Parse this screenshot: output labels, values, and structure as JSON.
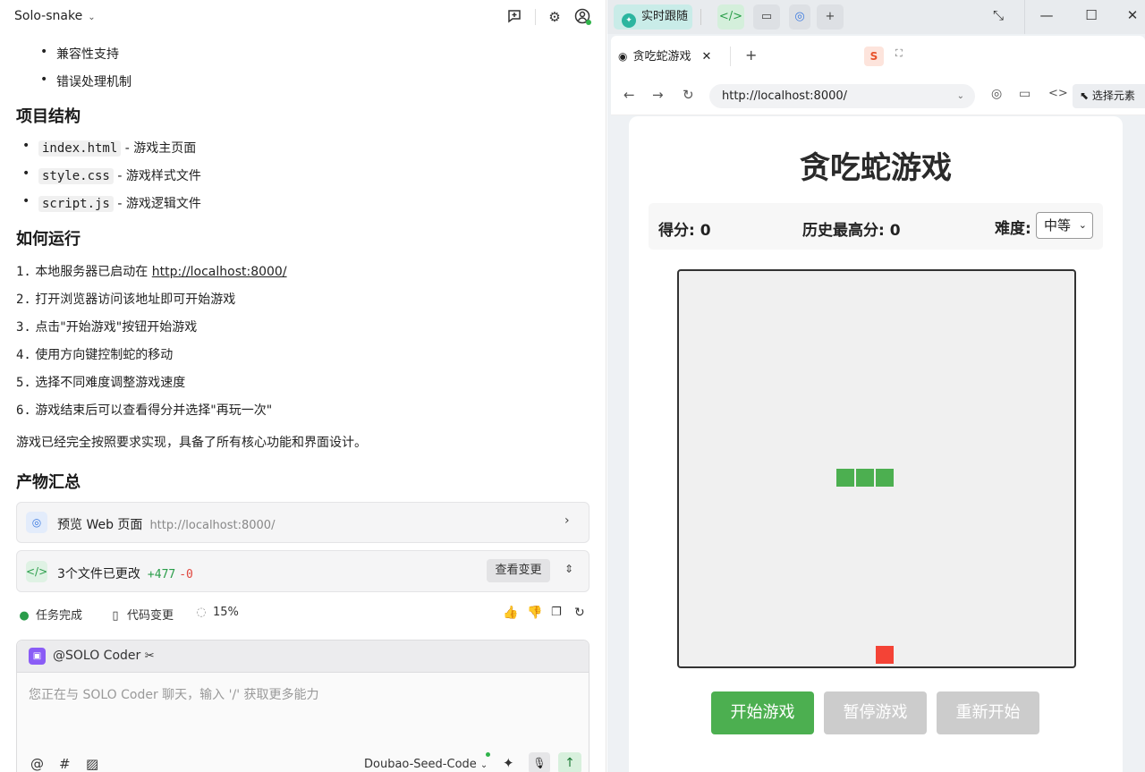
{
  "left": {
    "project_name": "Solo-snake",
    "top_bullets": [
      "兼容性支持",
      "错误处理机制"
    ],
    "structure_heading": "项目结构",
    "structure_items": [
      {
        "file": "index.html",
        "desc": "- 游戏主页面"
      },
      {
        "file": "style.css",
        "desc": "- 游戏样式文件"
      },
      {
        "file": "script.js",
        "desc": "- 游戏逻辑文件"
      }
    ],
    "run_heading": "如何运行",
    "run_steps": [
      {
        "num": "1.",
        "text": "本地服务器已启动在 ",
        "link": "http://localhost:8000/"
      },
      {
        "num": "2.",
        "text": "打开浏览器访问该地址即可开始游戏"
      },
      {
        "num": "3.",
        "text": "点击\"开始游戏\"按钮开始游戏"
      },
      {
        "num": "4.",
        "text": "使用方向键控制蛇的移动"
      },
      {
        "num": "5.",
        "text": "选择不同难度调整游戏速度"
      },
      {
        "num": "6.",
        "text": "游戏结束后可以查看得分并选择\"再玩一次\""
      }
    ],
    "summary": "游戏已经完全按照要求实现，具备了所有核心功能和界面设计。",
    "artifacts_heading": "产物汇总",
    "preview_card": {
      "label": "预览 Web 页面",
      "url": "http://localhost:8000/"
    },
    "changes_card": {
      "label": "3个文件已更改",
      "plus": "+477",
      "minus": "-0",
      "button": "查看变更"
    },
    "status": {
      "done": "任务完成",
      "code_change": "代码变更",
      "progress": "15%"
    },
    "chat": {
      "agent": "@SOLO Coder",
      "placeholder": "您正在与 SOLO Coder 聊天，输入 '/' 获取更多能力",
      "model": "Doubao-Seed-Code"
    }
  },
  "right": {
    "follow_label": "实时跟随",
    "tab_title": "贪吃蛇游戏",
    "url": "http://localhost:8000/",
    "select_element": "选择元素",
    "game": {
      "title": "贪吃蛇游戏",
      "score": "得分: 0",
      "high_score": "历史最高分: 0",
      "difficulty_label": "难度:",
      "difficulty_value": "中等",
      "buttons": {
        "start": "开始游戏",
        "pause": "暂停游戏",
        "restart": "重新开始"
      },
      "colors": {
        "snake": "#4caf50",
        "food": "#f44336",
        "board": "#f0f0f0"
      }
    }
  }
}
